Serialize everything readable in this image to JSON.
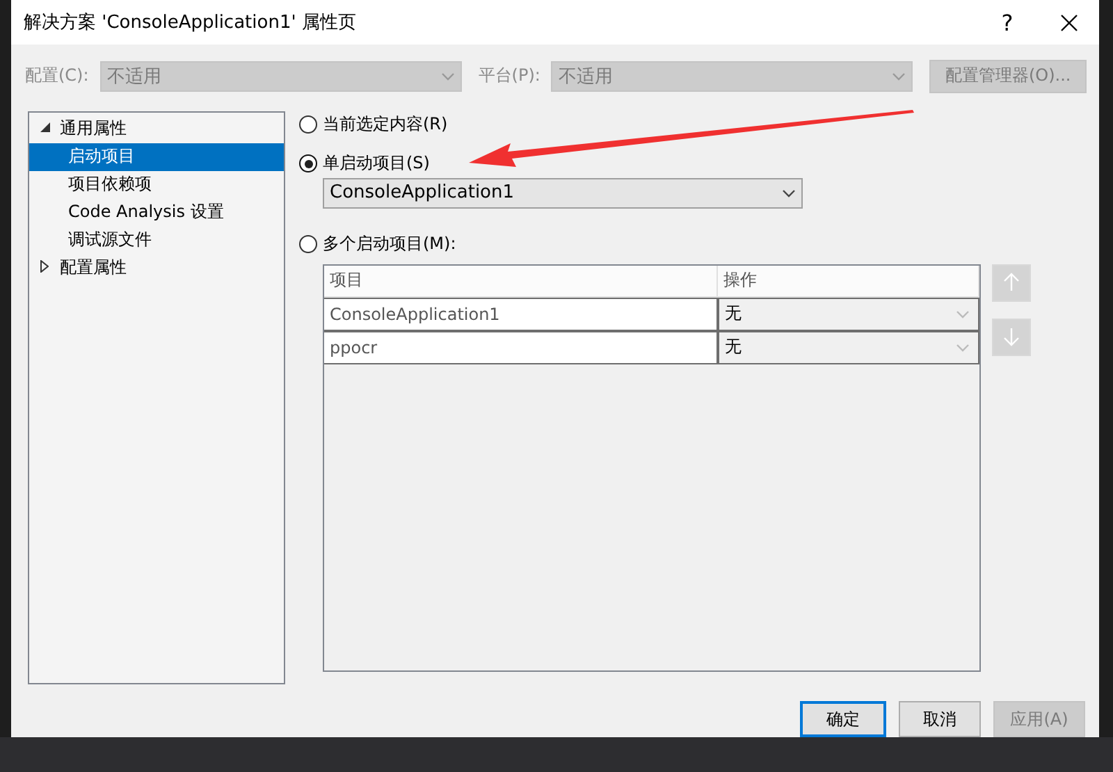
{
  "window": {
    "title": "解决方案 'ConsoleApplication1' 属性页",
    "help": "?"
  },
  "config_bar": {
    "configuration_label": "配置(C):",
    "configuration_value": "不适用",
    "configuration_disabled": true,
    "platform_label": "平台(P):",
    "platform_value": "不适用",
    "platform_disabled": true,
    "manager_button": {
      "label": "配置管理器(O)...",
      "disabled": true
    }
  },
  "tree": [
    {
      "label": "通用属性",
      "expanded": true,
      "selected": false,
      "children": [
        {
          "label": "启动项目",
          "selected": true
        },
        {
          "label": "项目依赖项",
          "selected": false
        },
        {
          "label": "Code Analysis 设置",
          "selected": false
        },
        {
          "label": "调试源文件",
          "selected": false
        }
      ]
    },
    {
      "label": "配置属性",
      "expanded": false,
      "selected": false
    }
  ],
  "startup_options": [
    {
      "label": "当前选定内容(R)",
      "selected": false
    },
    {
      "label": "单启动项目(S)",
      "selected": true
    },
    {
      "label": "多个启动项目(M):",
      "selected": false
    }
  ],
  "single_project": {
    "value": "ConsoleApplication1"
  },
  "multi_grid": {
    "columns": [
      "项目",
      "操作"
    ],
    "rows": [
      {
        "project": "ConsoleApplication1",
        "action": "无"
      },
      {
        "project": "ppocr",
        "action": "无"
      }
    ],
    "move_up_disabled": true,
    "move_down_disabled": true
  },
  "buttons": [
    {
      "label": "确定",
      "kind": "primary",
      "disabled": false
    },
    {
      "label": "取消",
      "kind": "normal",
      "disabled": false
    },
    {
      "label": "应用(A)",
      "kind": "normal",
      "disabled": true
    }
  ]
}
